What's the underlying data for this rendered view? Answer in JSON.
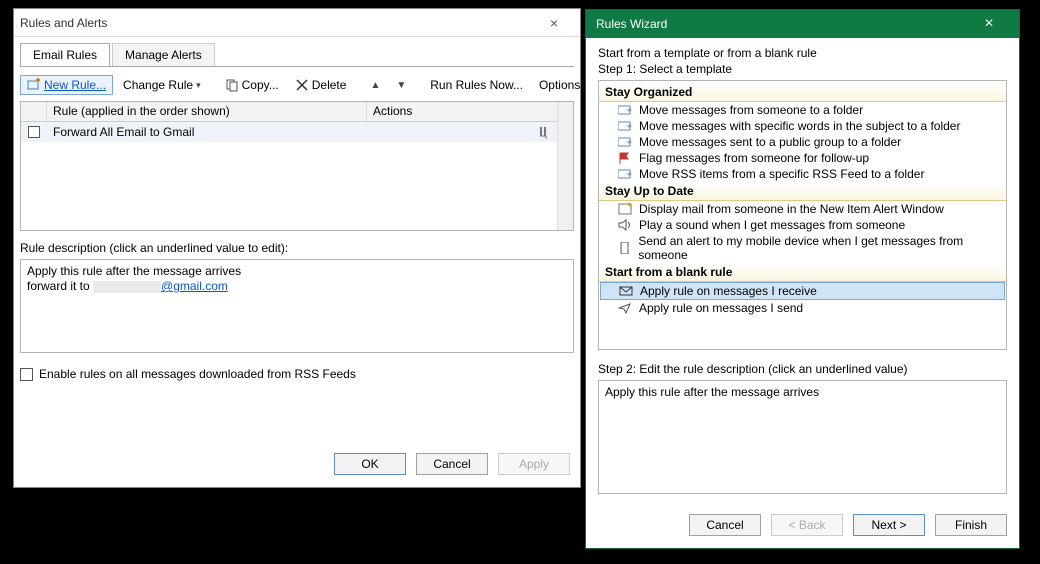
{
  "rules_dialog": {
    "title": "Rules and Alerts",
    "tabs": {
      "email": "Email Rules",
      "alerts": "Manage Alerts"
    },
    "toolbar": {
      "new_rule": "New Rule...",
      "change_rule": "Change Rule",
      "copy": "Copy...",
      "delete": "Delete",
      "run_now": "Run Rules Now...",
      "options": "Options"
    },
    "grid": {
      "header_rule": "Rule (applied in the order shown)",
      "header_actions": "Actions",
      "row0_name": "Forward All Email to Gmail"
    },
    "desc_label": "Rule description (click an underlined value to edit):",
    "desc_line1": "Apply this rule after the message arrives",
    "desc_fwd_prefix": "forward it to ",
    "desc_fwd_suffix": "@gmail.com",
    "rss_label": "Enable rules on all messages downloaded from RSS Feeds",
    "buttons": {
      "ok": "OK",
      "cancel": "Cancel",
      "apply": "Apply"
    }
  },
  "wizard": {
    "title": "Rules Wizard",
    "header1": "Start from a template or from a blank rule",
    "header2": "Step 1: Select a template",
    "group_organized": "Stay Organized",
    "opts_org": [
      "Move messages from someone to a folder",
      "Move messages with specific words in the subject to a folder",
      "Move messages sent to a public group to a folder",
      "Flag messages from someone for follow-up",
      "Move RSS items from a specific RSS Feed to a folder"
    ],
    "group_uptodate": "Stay Up to Date",
    "opts_upd": [
      "Display mail from someone in the New Item Alert Window",
      "Play a sound when I get messages from someone",
      "Send an alert to my mobile device when I get messages from someone"
    ],
    "group_blank": "Start from a blank rule",
    "opts_blank": [
      "Apply rule on messages I receive",
      "Apply rule on messages I send"
    ],
    "step2_label": "Step 2: Edit the rule description (click an underlined value)",
    "step2_text": "Apply this rule after the message arrives",
    "buttons": {
      "cancel": "Cancel",
      "back": "< Back",
      "next": "Next >",
      "finish": "Finish"
    }
  }
}
